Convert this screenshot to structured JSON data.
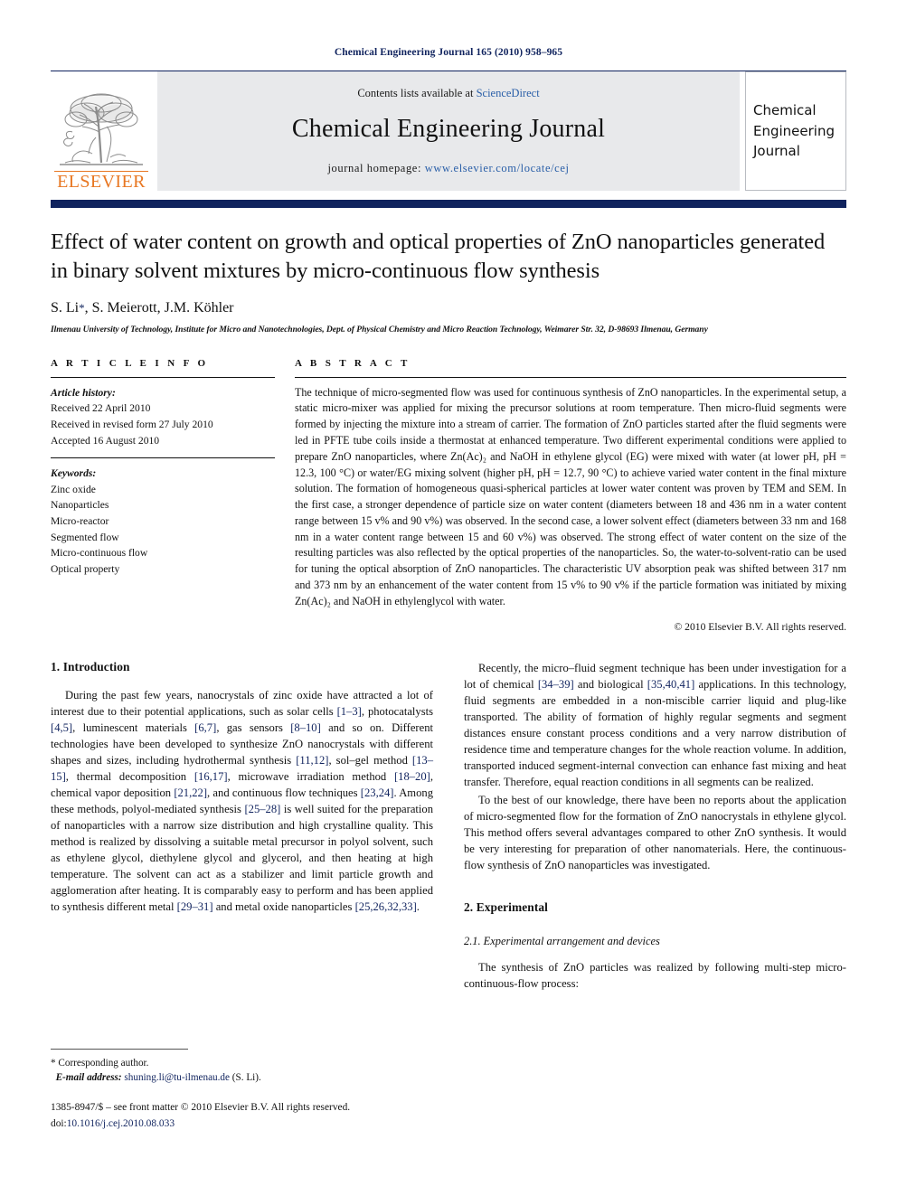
{
  "running_head": "Chemical Engineering Journal 165 (2010) 958–965",
  "masthead": {
    "contents_prefix": "Contents lists available at ",
    "sciencedirect": "ScienceDirect",
    "journal_title": "Chemical Engineering Journal",
    "homepage_prefix": "journal homepage:",
    "homepage_url": "www.elsevier.com/locate/cej",
    "publisher": "ELSEVIER",
    "cover_lines": [
      "Chemical",
      "Engineering",
      "Journal"
    ],
    "link_color": "#2a5fa8",
    "brand_color": "#e87722",
    "bar_color": "#10235e"
  },
  "article": {
    "title": "Effect of water content on growth and optical properties of ZnO nanoparticles generated in binary solvent mixtures by micro-continuous flow synthesis",
    "authors": "S. Li",
    "authors_rest": ", S. Meierott, J.M. Köhler",
    "corresponding_marker": "*",
    "affiliation": "Ilmenau University of Technology, Institute for Micro and Nanotechnologies, Dept. of Physical Chemistry and Micro Reaction Technology, Weimarer Str. 32, D-98693 Ilmenau, Germany"
  },
  "article_info": {
    "heading": "A R T I C L E   I N F O",
    "history_label": "Article history:",
    "history": [
      "Received 22 April 2010",
      "Received in revised form 27 July 2010",
      "Accepted 16 August 2010"
    ],
    "keywords_label": "Keywords:",
    "keywords": [
      "Zinc oxide",
      "Nanoparticles",
      "Micro-reactor",
      "Segmented flow",
      "Micro-continuous flow",
      "Optical property"
    ]
  },
  "abstract": {
    "heading": "A B S T R A C T",
    "text": "The technique of micro-segmented flow was used for continuous synthesis of ZnO nanoparticles. In the experimental setup, a static micro-mixer was applied for mixing the precursor solutions at room temperature. Then micro-fluid segments were formed by injecting the mixture into a stream of carrier. The formation of ZnO particles started after the fluid segments were led in PFTE tube coils inside a thermostat at enhanced temperature. Two different experimental conditions were applied to prepare ZnO nanoparticles, where Zn(Ac)₂ and NaOH in ethylene glycol (EG) were mixed with water (at lower pH, pH = 12.3, 100 °C) or water/EG mixing solvent (higher pH, pH = 12.7, 90 °C) to achieve varied water content in the final mixture solution. The formation of homogeneous quasi-spherical particles at lower water content was proven by TEM and SEM. In the first case, a stronger dependence of particle size on water content (diameters between 18 and 436 nm in a water content range between 15 v% and 90 v%) was observed. In the second case, a lower solvent effect (diameters between 33 nm and 168 nm in a water content range between 15 and 60 v%) was observed. The strong effect of water content on the size of the resulting particles was also reflected by the optical properties of the nanoparticles. So, the water-to-solvent-ratio can be used for tuning the optical absorption of ZnO nanoparticles. The characteristic UV absorption peak was shifted between 317 nm and 373 nm by an enhancement of the water content from 15 v% to 90 v% if the particle formation was initiated by mixing Zn(Ac)₂ and NaOH in ethylenglycol with water.",
    "copyright": "© 2010 Elsevier B.V. All rights reserved."
  },
  "sections": {
    "introduction_heading": "1. Introduction",
    "experimental_heading": "2. Experimental",
    "experimental_sub_heading": "2.1. Experimental arrangement and devices"
  },
  "paragraphs": {
    "intro_p1_a": "During the past few years, nanocrystals of zinc oxide have attracted a lot of interest due to their potential applications, such as solar cells ",
    "intro_ref_1_3": "[1–3]",
    "intro_p1_b": ", photocatalysts ",
    "intro_ref_4_5": "[4,5]",
    "intro_p1_c": ", luminescent materials ",
    "intro_ref_6_7": "[6,7]",
    "intro_p1_d": ", gas sensors ",
    "intro_ref_8_10": "[8–10]",
    "intro_p1_e": " and so on. Different technologies have been developed to synthesize ZnO nanocrystals with different shapes and sizes, including hydrothermal synthesis ",
    "intro_ref_11_12": "[11,12]",
    "intro_p1_f": ", sol–gel method ",
    "intro_ref_13_15": "[13–15]",
    "intro_p1_g": ", thermal decomposition ",
    "intro_ref_16_17": "[16,17]",
    "intro_p1_h": ", microwave irradiation method ",
    "intro_ref_18_20": "[18–20]",
    "intro_p1_i": ", chemical vapor deposition ",
    "intro_ref_21_22": "[21,22]",
    "intro_p1_j": ", and continuous flow techniques ",
    "intro_ref_23_24": "[23,24]",
    "intro_p1_k": ". Among these methods, polyol-mediated synthesis ",
    "intro_ref_25_28": "[25–28]",
    "intro_p1_l": " is well suited for the preparation of nanoparticles with a narrow size distribution and high crystalline quality. This method is realized by dissolving a suitable metal precursor in polyol solvent, such as ethylene glycol, diethylene glycol and glycerol, and then heating at high temperature. The solvent can act as a stabilizer and limit particle growth and agglomeration after heating. It is comparably easy to perform and has been applied to synthesis different metal ",
    "intro_ref_29_31": "[29–31]",
    "intro_p1_m": " and metal oxide nanoparticles ",
    "intro_ref_25_26_32_33": "[25,26,32,33]",
    "intro_p1_n": ".",
    "intro_p2_a": "Recently, the micro–fluid segment technique has been under investigation for a lot of chemical ",
    "intro_ref_34_39": "[34–39]",
    "intro_p2_b": " and biological ",
    "intro_ref_35_40_41": "[35,40,41]",
    "intro_p2_c": " applications. In this technology, fluid segments are embedded in a non-miscible carrier liquid and plug-like transported. The ability of formation of highly regular segments and segment distances ensure constant process conditions and a very narrow distribution of residence time and temperature changes for the whole reaction volume. In addition, transported induced segment-internal convection can enhance fast mixing and heat transfer. Therefore, equal reaction conditions in all segments can be realized.",
    "intro_p3": "To the best of our knowledge, there have been no reports about the application of micro-segmented flow for the formation of ZnO nanocrystals in ethylene glycol. This method offers several advantages compared to other ZnO synthesis. It would be very interesting for preparation of other nanomaterials. Here, the continuous-flow synthesis of ZnO nanoparticles was investigated.",
    "experimental_p1": "The synthesis of ZnO particles was realized by following multi-step micro-continuous-flow process:"
  },
  "footnote": {
    "corresponding": "* Corresponding author.",
    "email_label": "E-mail address:",
    "email": "shuning.li@tu-ilmenau.de",
    "email_suffix": " (S. Li).",
    "issn_line": "1385-8947/$ – see front matter © 2010 Elsevier B.V. All rights reserved.",
    "doi_label": "doi:",
    "doi_value": "10.1016/j.cej.2010.08.033"
  }
}
